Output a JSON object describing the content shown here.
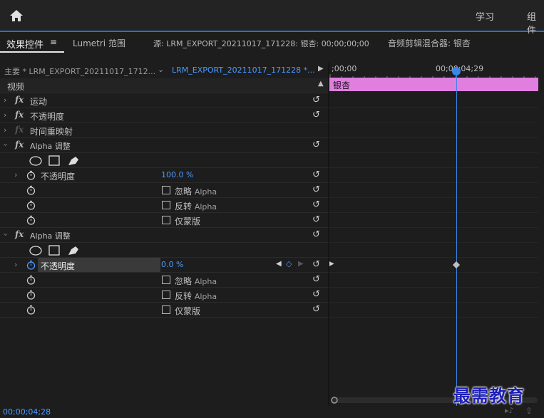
{
  "header": {
    "nav_learn": "学习",
    "nav_assemble": "组件"
  },
  "tabs": {
    "effects": "效果控件",
    "menu_glyph": "≡",
    "lumetri": "Lumetri 范围",
    "source": "源: LRM_EXPORT_20211017_171228: 银杏: 00;00;00;00",
    "audio_mixer": "音频剪辑混合器: 银杏"
  },
  "source_row": {
    "master": "主要 * LRM_EXPORT_20211017_1712...",
    "sequence": "LRM_EXPORT_20211017_171228 *...",
    "time_start": ";00;00",
    "time_playhead": "00;00;04;29"
  },
  "section": {
    "video": "视频"
  },
  "effects": {
    "motion": "运动",
    "opacity": "不透明度",
    "time_remap": "时间重映射",
    "alpha1_title": "Alpha 调整",
    "alpha1_opacity_label": "不透明度",
    "alpha1_opacity_value": "100.0 %",
    "ignore_alpha": "忽略",
    "invert_alpha": "反转",
    "mask_only": "仅蒙版",
    "alpha_word": "Alpha",
    "alpha2_title": "Alpha 调整",
    "alpha2_opacity_label": "不透明度",
    "alpha2_opacity_value": "0.0 %"
  },
  "timeline": {
    "clip_name": "银杏",
    "clip_color": "#e07fe0",
    "playhead_color": "#3a86e6"
  },
  "footer": {
    "timecode": "00;00;04;28",
    "watermark": "最需教育"
  }
}
